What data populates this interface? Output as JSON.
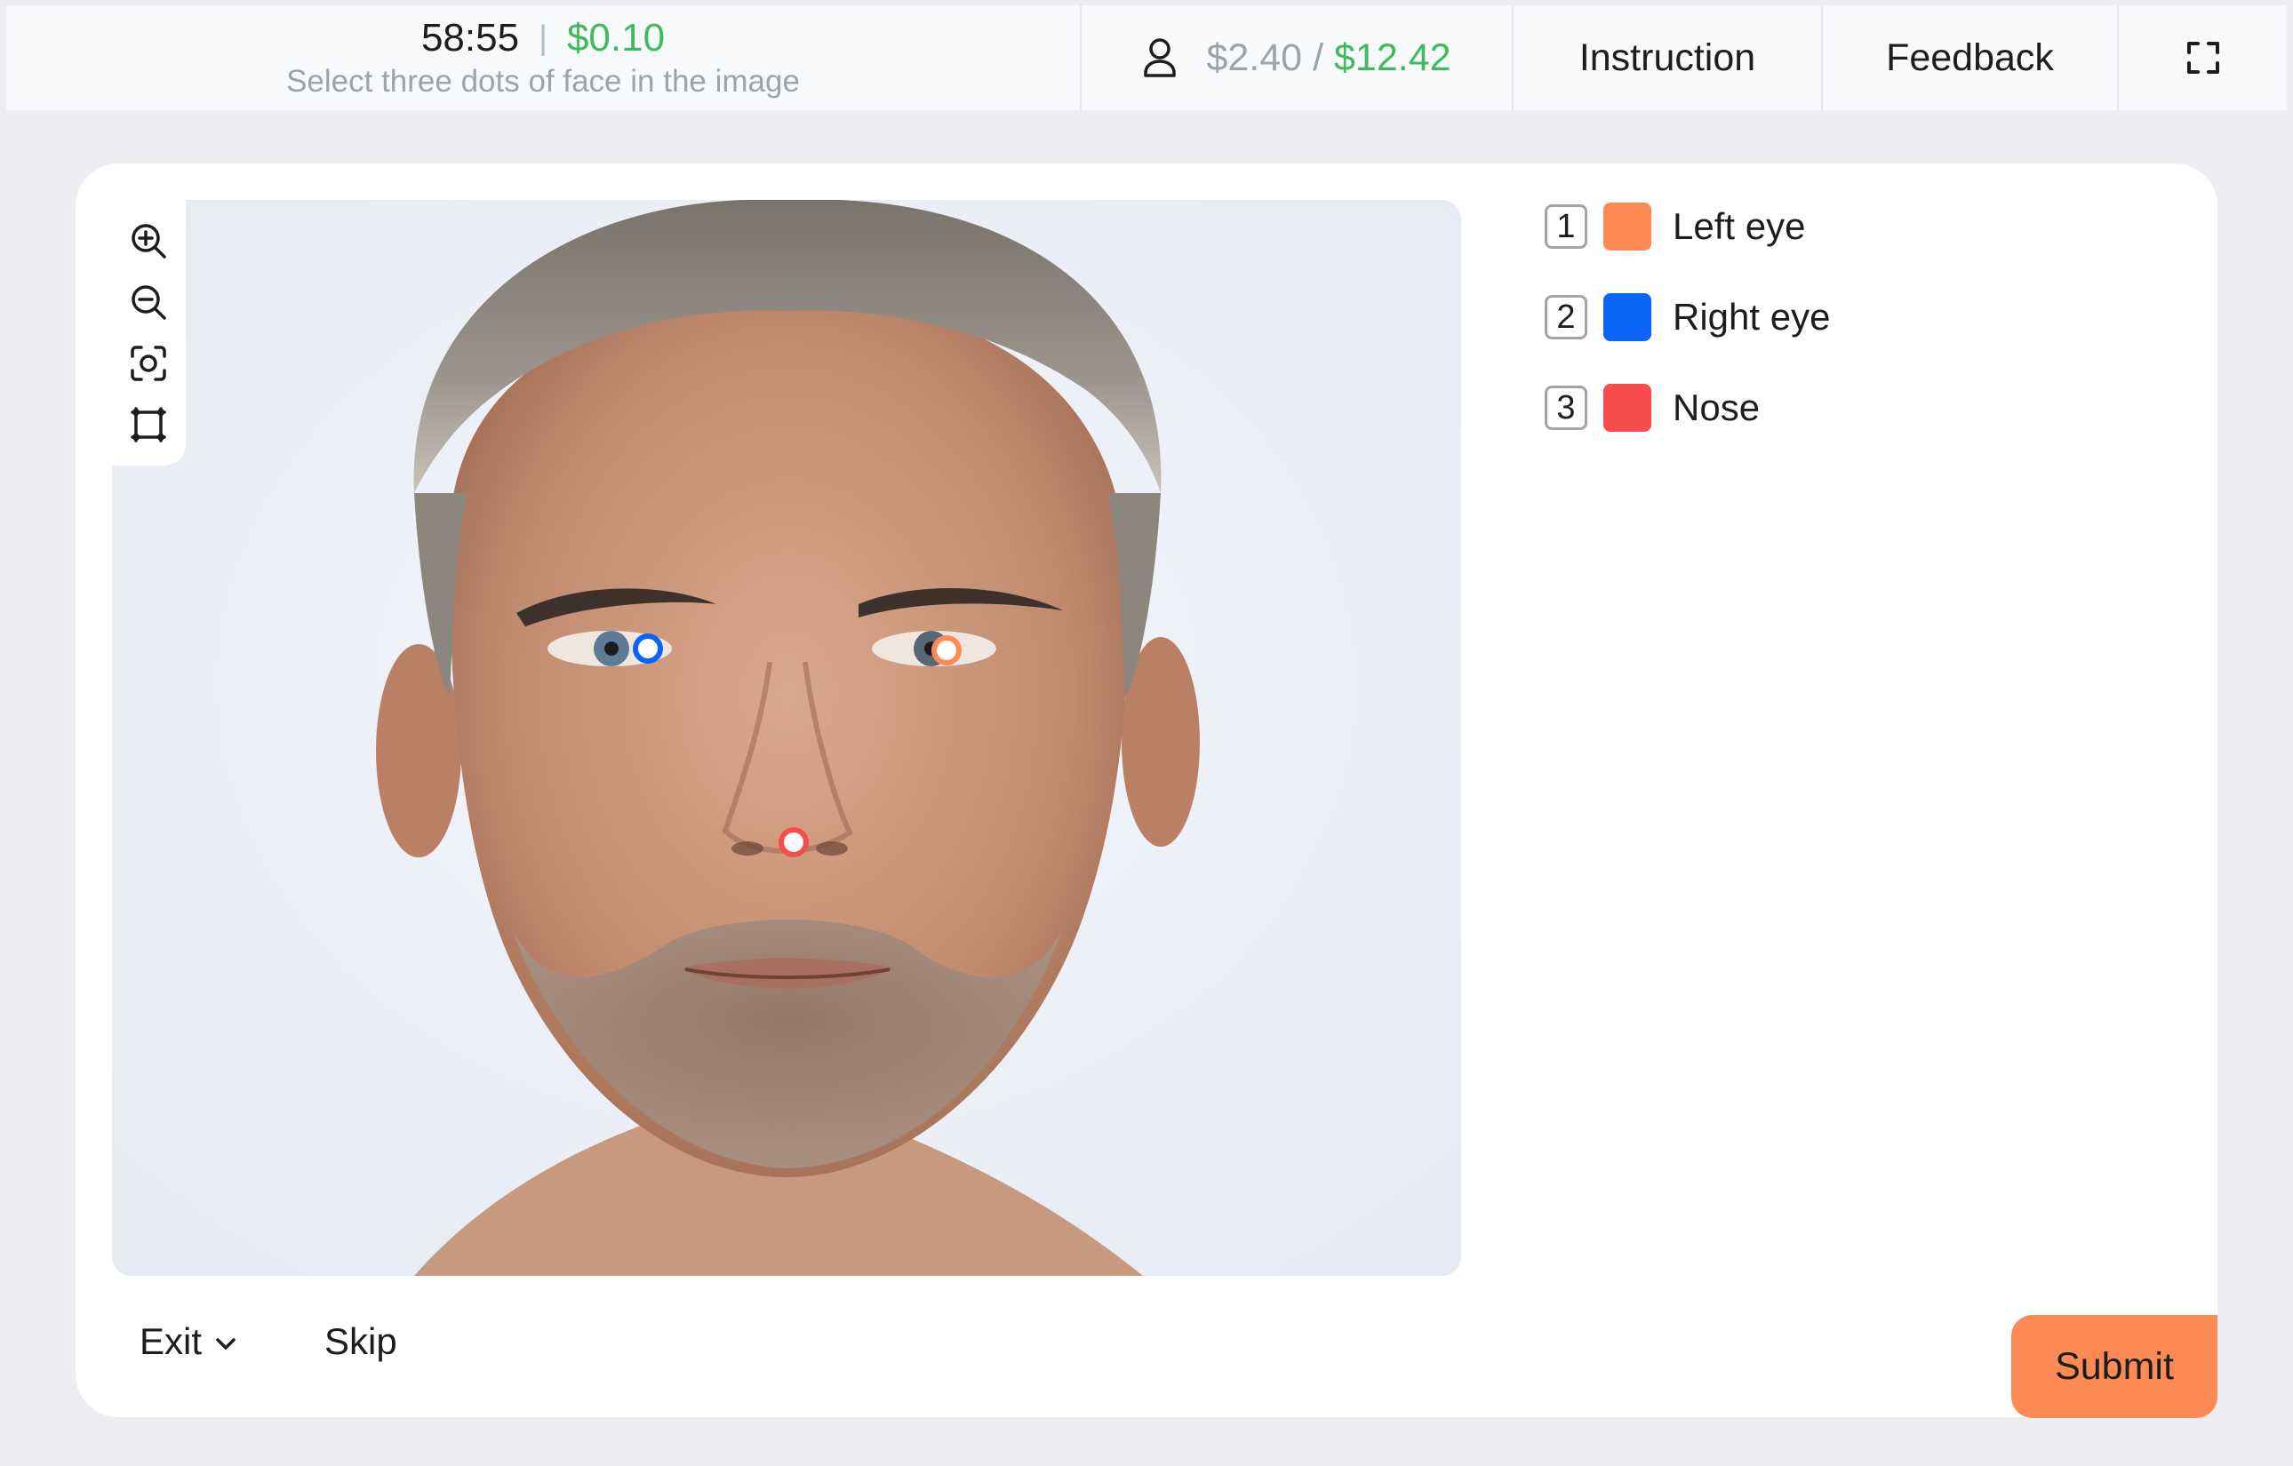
{
  "header": {
    "timer": "58:55",
    "separator": "|",
    "task_price": "$0.10",
    "task_hint": "Select three dots of face in the image",
    "balance_current": "$2.40",
    "balance_separator": "/",
    "balance_total": "$12.42",
    "instruction_label": "Instruction",
    "feedback_label": "Feedback",
    "fullscreen_icon": "fullscreen-icon",
    "user_icon": "user-icon"
  },
  "toolbar": {
    "tools": [
      "zoom-in-icon",
      "zoom-out-icon",
      "focus-icon",
      "bounding-box-icon"
    ]
  },
  "labels": [
    {
      "num": "1",
      "label": "Left eye",
      "color": "#fc8a55"
    },
    {
      "num": "2",
      "label": "Right eye",
      "color": "#0a64f5"
    },
    {
      "num": "3",
      "label": "Nose",
      "color": "#f84c4c"
    }
  ],
  "actions": {
    "exit_label": "Exit",
    "skip_label": "Skip",
    "submit_label": "Submit"
  },
  "colors": {
    "accent_green": "#3dbb5e",
    "submit_orange": "#fc8a55"
  }
}
